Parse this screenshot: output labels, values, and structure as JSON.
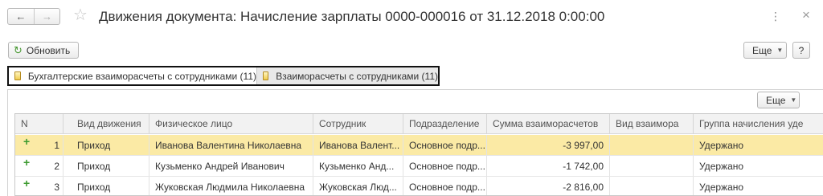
{
  "window": {
    "title": "Движения документа: Начисление зарплаты 0000-000016 от 31.12.2018 0:00:00",
    "back_icon": "←",
    "forward_icon": "→",
    "favorite_icon": "☆",
    "menu_icon": "⋮",
    "close_icon": "×"
  },
  "toolbar": {
    "refresh_label": "Обновить",
    "refresh_icon": "↻",
    "more_label": "Еще",
    "help_label": "?"
  },
  "tabs": [
    {
      "label": "Бухгалтерские взаиморасчеты с сотрудниками (11)"
    },
    {
      "label": "Взаиморасчеты с сотрудниками (11)"
    }
  ],
  "table": {
    "more_label": "Еще",
    "columns": [
      "N",
      "Вид движения",
      "Физическое лицо",
      "Сотрудник",
      "Подразделение",
      "Сумма взаиморасчетов",
      "Вид взаимора",
      "Группа начисления уде"
    ],
    "rows": [
      {
        "mark": "+",
        "n": "1",
        "kind": "Приход",
        "person": "Иванова Валентина Николаевна",
        "employee": "Иванова Валент...",
        "dept": "Основное подр...",
        "amount": "-3 997,00",
        "type": "",
        "group": "Удержано"
      },
      {
        "mark": "+",
        "n": "2",
        "kind": "Приход",
        "person": "Кузьменко Андрей Иванович",
        "employee": "Кузьменко Анд...",
        "dept": "Основное подр...",
        "amount": "-1 742,00",
        "type": "",
        "group": "Удержано"
      },
      {
        "mark": "+",
        "n": "3",
        "kind": "Приход",
        "person": "Жуковская Людмила Николаевна",
        "employee": "Жуковская Люд...",
        "dept": "Основное подр...",
        "amount": "-2 816,00",
        "type": "",
        "group": "Удержано"
      }
    ],
    "selected_row_color": "#fbeaa5"
  }
}
